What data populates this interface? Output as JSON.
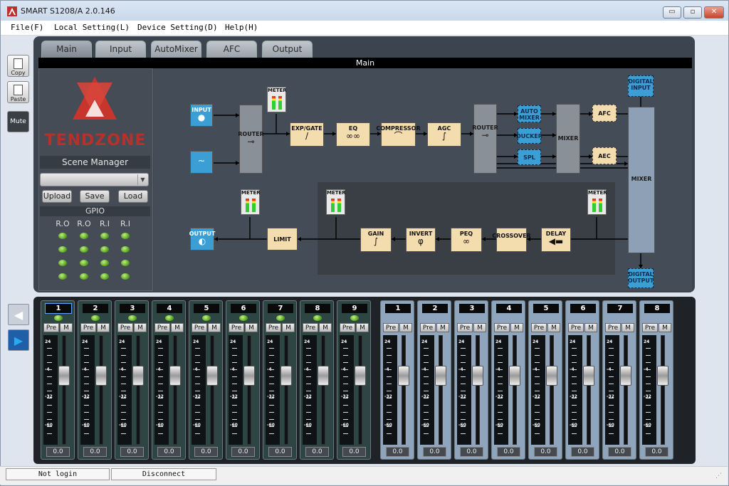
{
  "window": {
    "title": "SMART S1208/A 2.0.146",
    "minimize_glyph": "▭",
    "restore_glyph": "▫",
    "close_glyph": "✕"
  },
  "menu": [
    "File(F)",
    "Local Setting(L)",
    "Device Setting(D)",
    "Help(H)"
  ],
  "sidebar": {
    "copy": "Copy",
    "paste": "Paste",
    "mute": "Mute",
    "prev_glyph": "◀",
    "next_glyph": "▶"
  },
  "tabs": [
    "Main",
    "Input",
    "AutoMixer",
    "AFC",
    "Output"
  ],
  "active_tab": "Main",
  "main_header": "Main",
  "brand": "TENDZONE",
  "scene": {
    "title": "Scene Manager",
    "selected": "",
    "dropdown_glyph": "▼",
    "upload": "Upload",
    "save": "Save",
    "load": "Load"
  },
  "gpio": {
    "title": "GPIO",
    "headers": [
      "R.O",
      "R.O",
      "R.I",
      "R.I"
    ],
    "led_color": "#6fcf2f"
  },
  "blocks": {
    "input": "INPUT",
    "router1": "ROUTER",
    "router2": "ROUTER",
    "meter": "METER",
    "expgate": "EXP/GATE",
    "eq": "EQ",
    "compressor": "COMPRESSOR",
    "agc": "AGC",
    "automixer": "AUTO MIXER",
    "ducker": "DUCKER",
    "spl": "SPL",
    "mixer1": "MIXER",
    "afc": "AFC",
    "aec": "AEC",
    "digital_input": "DIGITAL INPUT",
    "mixer2": "MIXER",
    "digital_output": "DIGITAL OUTPUT",
    "output": "OUTPUT",
    "limit": "LIMIT",
    "gain": "GAIN",
    "invert": "INVERT",
    "peq": "PEQ",
    "crossover": "CROSSOVER",
    "delay": "DELAY",
    "invert_glyph": "φ"
  },
  "colors": {
    "block_tan": "#f3dcae",
    "block_blue": "#3b9fd6",
    "block_gray": "#8a9097",
    "panel": "#444c57",
    "brand_red": "#b7312b"
  },
  "input_strips": [
    {
      "num": "1",
      "pre": "Pre",
      "m": "M",
      "value": "0.0",
      "level": 0.66
    },
    {
      "num": "2",
      "pre": "Pre",
      "m": "M",
      "value": "0.0",
      "level": 0.66
    },
    {
      "num": "3",
      "pre": "Pre",
      "m": "M",
      "value": "0.0",
      "level": 0.66
    },
    {
      "num": "4",
      "pre": "Pre",
      "m": "M",
      "value": "0.0",
      "level": 0.66
    },
    {
      "num": "5",
      "pre": "Pre",
      "m": "M",
      "value": "0.0",
      "level": 0.66
    },
    {
      "num": "6",
      "pre": "Pre",
      "m": "M",
      "value": "0.0",
      "level": 0.66
    },
    {
      "num": "7",
      "pre": "Pre",
      "m": "M",
      "value": "0.0",
      "level": 0.66
    },
    {
      "num": "8",
      "pre": "Pre",
      "m": "M",
      "value": "0.0",
      "level": 0.66
    },
    {
      "num": "9",
      "pre": "Pre",
      "m": "M",
      "value": "0.0",
      "level": 0.66
    }
  ],
  "output_strips": [
    {
      "num": "1",
      "pre": "Pre",
      "m": "M",
      "value": "0.0",
      "level": 0.66
    },
    {
      "num": "2",
      "pre": "Pre",
      "m": "M",
      "value": "0.0",
      "level": 0.66
    },
    {
      "num": "3",
      "pre": "Pre",
      "m": "M",
      "value": "0.0",
      "level": 0.66
    },
    {
      "num": "4",
      "pre": "Pre",
      "m": "M",
      "value": "0.0",
      "level": 0.66
    },
    {
      "num": "5",
      "pre": "Pre",
      "m": "M",
      "value": "0.0",
      "level": 0.66
    },
    {
      "num": "6",
      "pre": "Pre",
      "m": "M",
      "value": "0.0",
      "level": 0.66
    },
    {
      "num": "7",
      "pre": "Pre",
      "m": "M",
      "value": "0.0",
      "level": 0.66
    },
    {
      "num": "8",
      "pre": "Pre",
      "m": "M",
      "value": "0.0",
      "level": 0.66
    }
  ],
  "fader_scale": [
    "24",
    "-4",
    "-32",
    "-60"
  ],
  "status": {
    "login": "Not login",
    "connection": "Disconnect"
  }
}
